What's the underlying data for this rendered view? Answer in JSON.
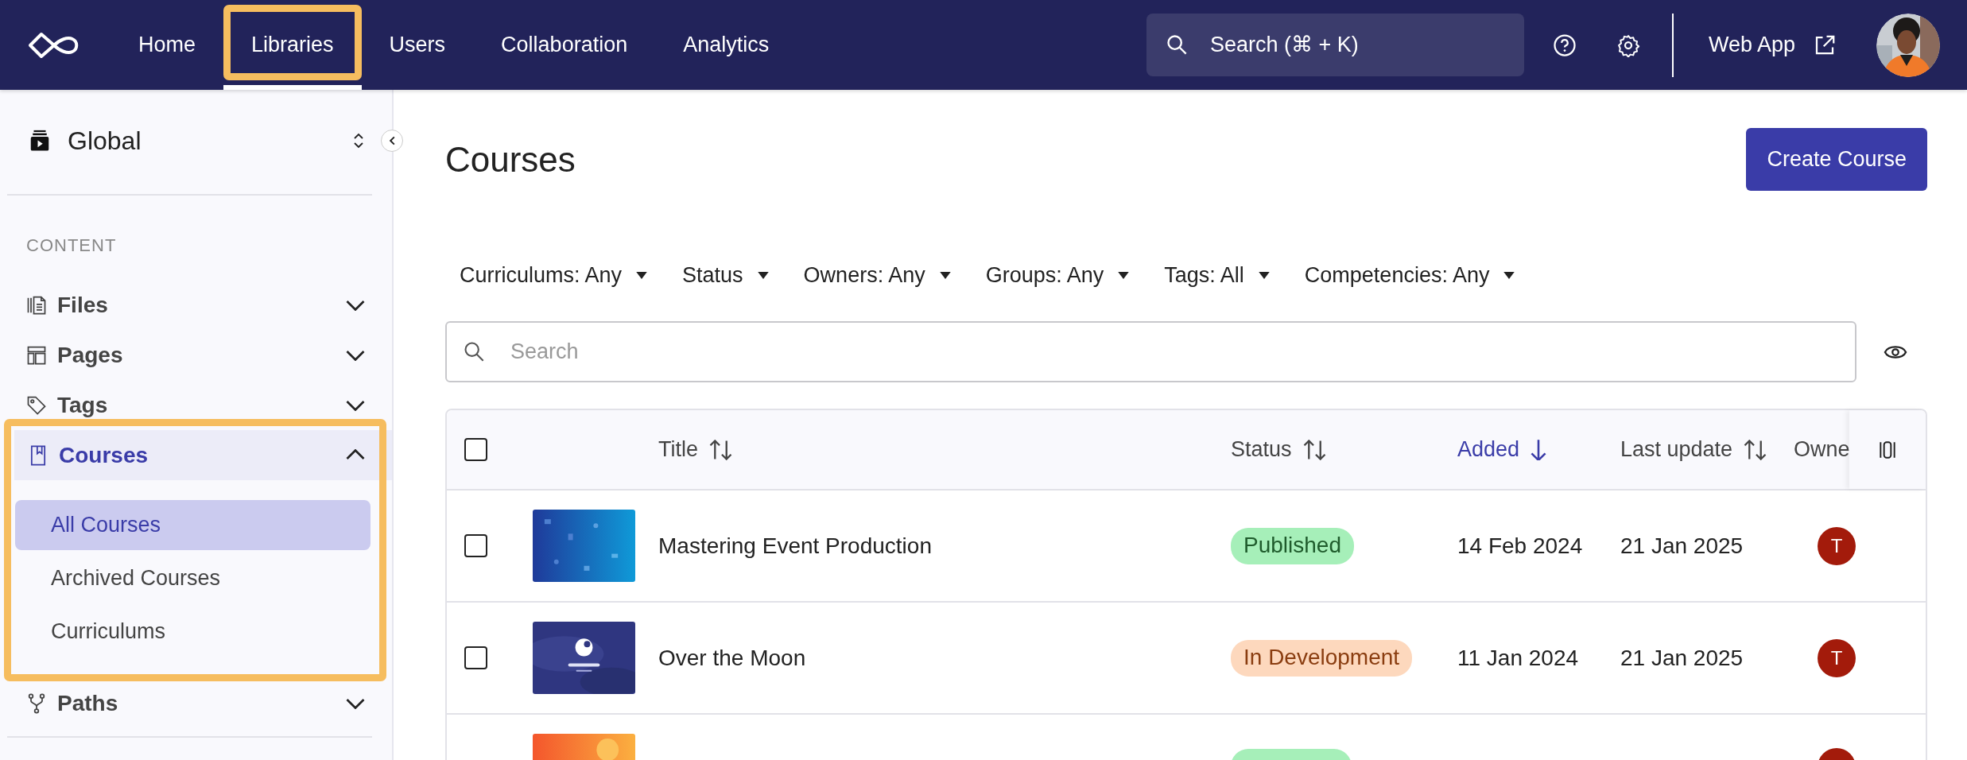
{
  "topbar": {
    "nav": [
      {
        "label": "Home",
        "selected": false,
        "highlighted": false
      },
      {
        "label": "Libraries",
        "selected": true,
        "highlighted": true
      },
      {
        "label": "Users",
        "selected": false,
        "highlighted": false
      },
      {
        "label": "Collaboration",
        "selected": false,
        "highlighted": false
      },
      {
        "label": "Analytics",
        "selected": false,
        "highlighted": false
      }
    ],
    "search": {
      "placeholder": "Search (⌘ + K)"
    },
    "web_app": "Web App"
  },
  "sidebar": {
    "workspace": "Global",
    "section": "CONTENT",
    "items": [
      {
        "label": "Files",
        "expanded": false,
        "selected": false,
        "highlighted": false
      },
      {
        "label": "Pages",
        "expanded": false,
        "selected": false,
        "highlighted": false
      },
      {
        "label": "Tags",
        "expanded": false,
        "selected": false,
        "highlighted": false
      },
      {
        "label": "Courses",
        "expanded": true,
        "selected": true,
        "highlighted": true,
        "children": [
          {
            "label": "All Courses",
            "selected": true
          },
          {
            "label": "Archived Courses",
            "selected": false
          },
          {
            "label": "Curriculums",
            "selected": false
          }
        ]
      },
      {
        "label": "Paths",
        "expanded": false,
        "selected": false,
        "highlighted": false
      }
    ]
  },
  "page": {
    "title": "Courses",
    "create_button": "Create Course",
    "filters": [
      "Curriculums: Any",
      "Status",
      "Owners: Any",
      "Groups: Any",
      "Tags: All",
      "Competencies: Any"
    ],
    "search": {
      "placeholder": "Search"
    }
  },
  "table": {
    "all_checked": false,
    "columns": [
      {
        "label": "Title",
        "sortable": true,
        "active": false
      },
      {
        "label": "Status",
        "sortable": true,
        "active": false
      },
      {
        "label": "Added",
        "sortable": true,
        "active": true
      },
      {
        "label": "Last update",
        "sortable": true,
        "active": false
      },
      {
        "label": "Owne",
        "sortable": false,
        "active": false
      }
    ],
    "rows": [
      {
        "checked": false,
        "title": "Mastering Event Production",
        "status": {
          "label": "Published",
          "kind": "published"
        },
        "added": "14 Feb 2024",
        "updated": "21 Jan 2025",
        "owner": {
          "initial": "T",
          "color": "#a31b0b"
        }
      },
      {
        "checked": false,
        "title": "Over the Moon",
        "status": {
          "label": "In Development",
          "kind": "development"
        },
        "added": "11 Jan 2024",
        "updated": "21 Jan 2025",
        "owner": {
          "initial": "T",
          "color": "#a31b0b"
        }
      },
      {
        "status": {
          "kind": "published"
        },
        "owner": {
          "color": "#a31b0b"
        }
      }
    ]
  }
}
